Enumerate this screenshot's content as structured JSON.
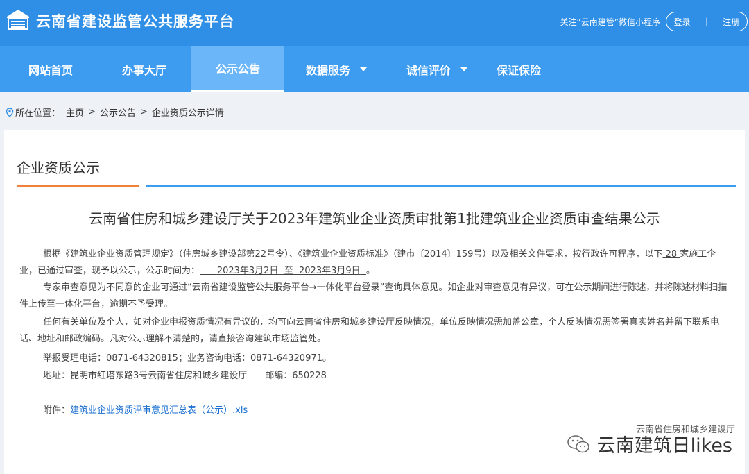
{
  "header": {
    "site_title": "云南省建设监管公共服务平台",
    "follow_text": "关注“云南建管”微信小程序",
    "login_label": "登录",
    "separator": "|",
    "register_label": "注册"
  },
  "nav": {
    "items": [
      {
        "label": "网站首页"
      },
      {
        "label": "办事大厅"
      },
      {
        "label": "公示公告"
      },
      {
        "label": "数据服务"
      },
      {
        "label": "诚信评价"
      },
      {
        "label": "保证保险"
      }
    ]
  },
  "breadcrumb": {
    "prefix": "所在位置：",
    "home": "主页",
    "sep": ">",
    "section": "公示公告",
    "current": "企业资质公示详情"
  },
  "content": {
    "section_title": "企业资质公示",
    "article_title": "云南省住房和城乡建设厅关于2023年建筑业企业资质审批第1批建筑业企业资质审查结果公示",
    "p1_a": "根据《建筑业企业资质管理规定》（住房城乡建设部第22号令）、《建筑业企业资质标准》（建市〔2014〕159号）以及相关文件要求，按行政许可程序，以下",
    "p1_count": "28",
    "p1_b": "家施工企业，已通过审查，现予以公示，公示时间为：",
    "p1_start": "2023年3月2日",
    "p1_to": "至",
    "p1_end": "2023年3月9日",
    "p1_c": "。",
    "p2": "专家审查意见为不同意的企业可通过“云南省建设监管公共服务平台→一体化平台登录”查询具体意见。如企业对审查意见有异议，可在公示期间进行陈述，并将陈述材料扫描件上传至一体化平台，逾期不予受理。",
    "p3": "任何有关单位及个人，如对企业申报资质情况有异议的，均可向云南省住房和城乡建设厅反映情况，单位反映情况需加盖公章，个人反映情况需签署真实姓名并留下联系电话、地址和邮政编码。凡对公示理解不清楚的，请直接咨询建筑市场监管处。",
    "p4": "举报受理电话：0871-64320815；业务咨询电话：0871-64320971。",
    "p5": "地址：昆明市红塔东路3号云南省住房和城乡建设厅　　邮编：650228",
    "attach_label": "附件：",
    "attach_link": "建筑业企业资质评审意见汇总表（公示）.xls"
  },
  "watermark": {
    "org": "云南省住房和城乡建设厅",
    "name": "云南建筑日likes"
  },
  "icons": {
    "logo": "building-logo-icon",
    "location": "location-pin-icon",
    "dropdown": "chevron-down-icon",
    "wechat": "wechat-icon"
  },
  "colors": {
    "header_bg": "#2f8fe6",
    "nav_bg": "#3d9bf0",
    "nav_active_bg": "#6bb6f8",
    "accent_orange": "#f0813b",
    "link": "#1a6fd0"
  }
}
